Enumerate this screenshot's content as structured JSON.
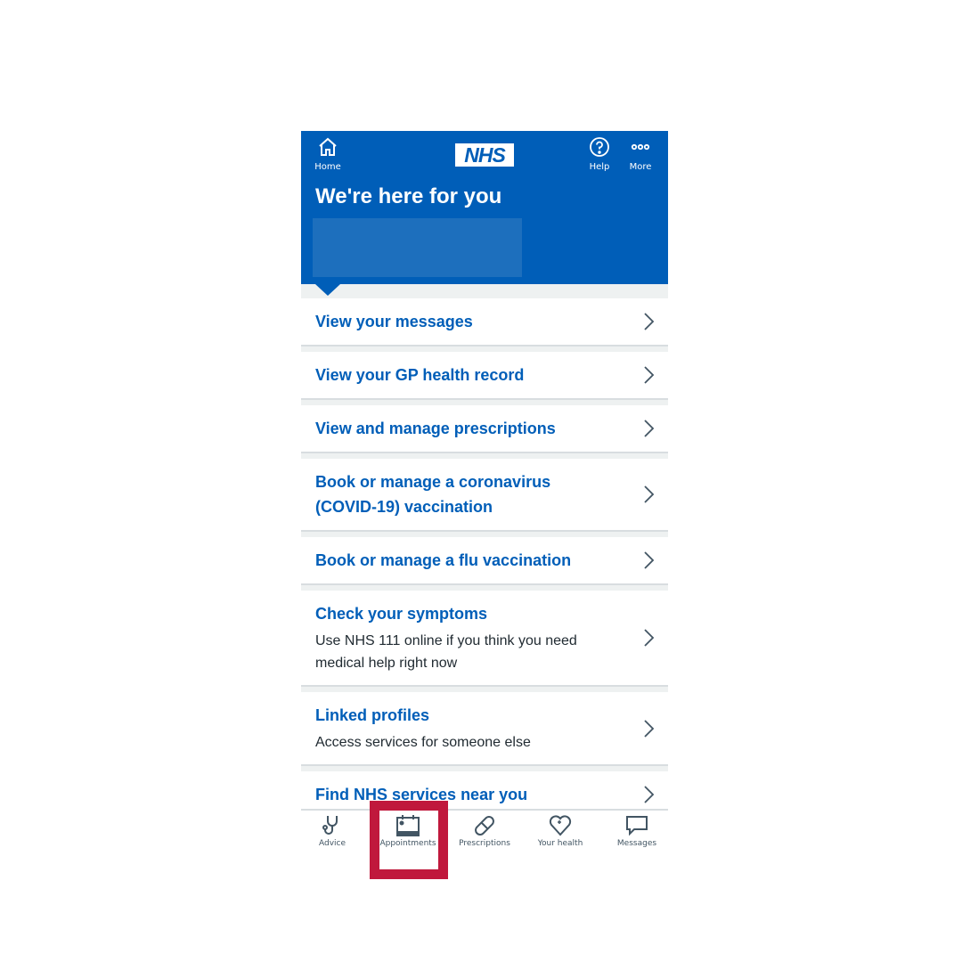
{
  "header": {
    "home_label": "Home",
    "logo_text": "NHS",
    "help_label": "Help",
    "more_label": "More",
    "title": "We're here for you",
    "brand_color": "#005eb8"
  },
  "menu": [
    {
      "title": "View your messages",
      "description": ""
    },
    {
      "title": "View your GP health record",
      "description": ""
    },
    {
      "title": "View and manage prescriptions",
      "description": ""
    },
    {
      "title": "Book or manage a coronavirus (COVID-19) vaccination",
      "description": ""
    },
    {
      "title": "Book or manage a flu vaccination",
      "description": ""
    },
    {
      "title": "Check your symptoms",
      "description": "Use NHS 111 online if you think you need medical help right now"
    },
    {
      "title": "Linked profiles",
      "description": "Access services for someone else"
    },
    {
      "title": "Find NHS services near you",
      "description": ""
    }
  ],
  "bottom_nav": [
    {
      "label": "Advice",
      "icon": "stethoscope-icon"
    },
    {
      "label": "Appointments",
      "icon": "calendar-icon",
      "highlighted": true
    },
    {
      "label": "Prescriptions",
      "icon": "pill-icon"
    },
    {
      "label": "Your health",
      "icon": "heart-plus-icon"
    },
    {
      "label": "Messages",
      "icon": "speech-bubble-icon"
    }
  ],
  "highlight_color": "#c0183c"
}
